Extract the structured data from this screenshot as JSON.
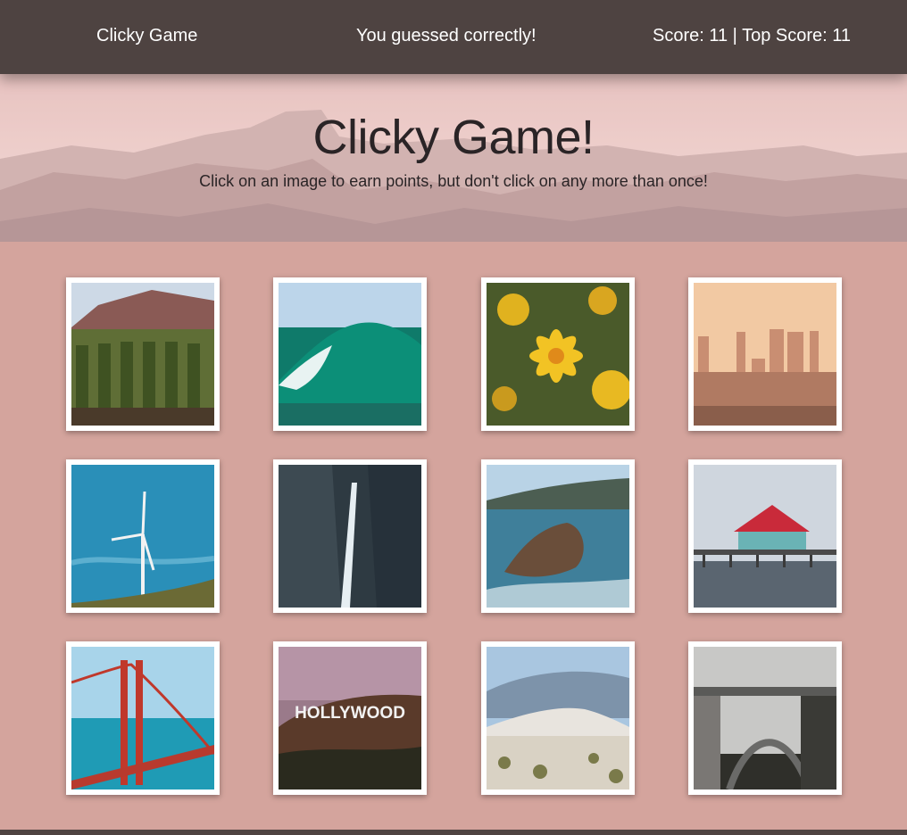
{
  "navbar": {
    "brand": "Clicky Game",
    "message": "You guessed correctly!",
    "score_text": "Score: 11 | Top Score: 11"
  },
  "header": {
    "title": "Clicky Game!",
    "subtitle": "Click on an image to earn points, but don't click on any more than once!"
  },
  "cards": [
    {
      "subject": "vineyard-hills"
    },
    {
      "subject": "ocean-wave"
    },
    {
      "subject": "yellow-flowers"
    },
    {
      "subject": "city-skyline-haze"
    },
    {
      "subject": "wind-turbine"
    },
    {
      "subject": "waterfall-cliff"
    },
    {
      "subject": "sea-rocks"
    },
    {
      "subject": "pier-pavilion"
    },
    {
      "subject": "golden-gate-bridge"
    },
    {
      "subject": "hollywood-sign",
      "sign_text": "HOLLYWOOD"
    },
    {
      "subject": "sand-dunes"
    },
    {
      "subject": "arch-bridge-fog"
    }
  ],
  "colors": {
    "navbar_bg": "#4e4341",
    "page_bg": "#d4a49d",
    "text_dark": "#2a2426"
  }
}
